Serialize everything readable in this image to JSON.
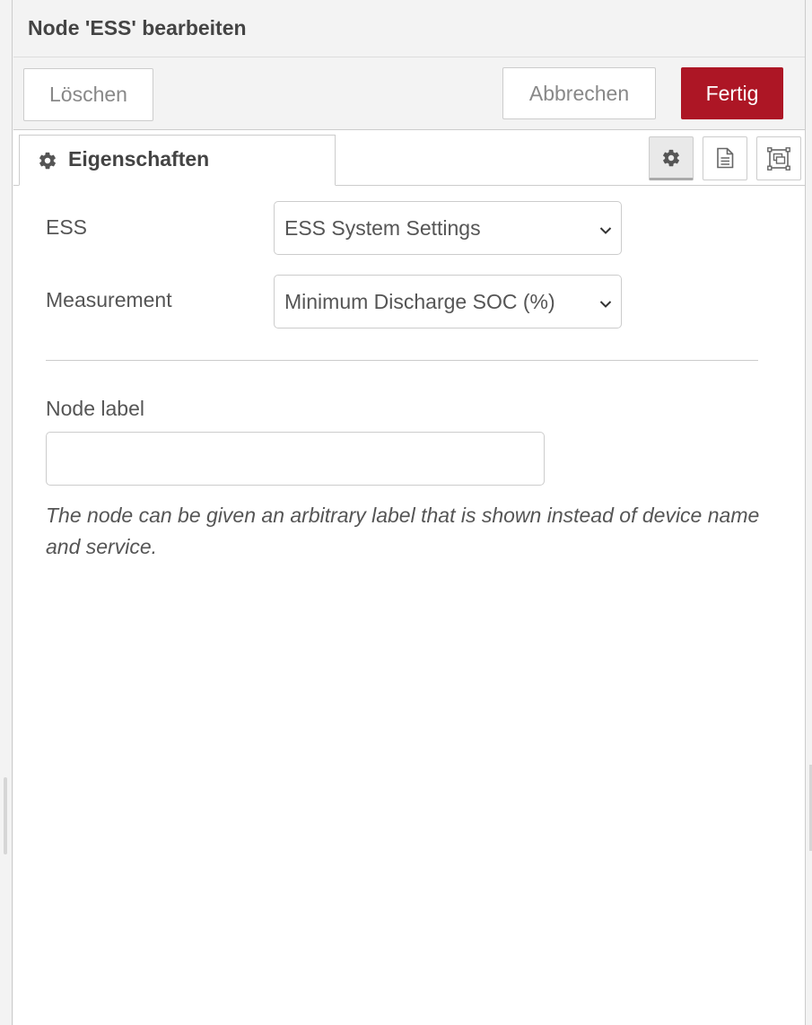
{
  "window": {
    "title": "Node 'ESS' bearbeiten"
  },
  "toolbar": {
    "delete_label": "Löschen",
    "cancel_label": "Abbrechen",
    "done_label": "Fertig"
  },
  "tabs": {
    "properties_label": "Eigenschaften",
    "properties_icon": "gear-icon",
    "right_buttons": [
      "gear-icon",
      "file-text-icon",
      "window-restore-icon"
    ]
  },
  "form": {
    "ess_label": "ESS",
    "ess_value": "ESS System Settings",
    "measurement_label": "Measurement",
    "measurement_value": "Minimum Discharge SOC (%)",
    "node_label_label": "Node label",
    "node_label_value": "",
    "help_text": "The node can be given an arbitrary label that is shown instead of device name and service."
  },
  "colors": {
    "primary_button": "#ad1625",
    "background": "#f3f3f3",
    "border": "#cccccc"
  }
}
